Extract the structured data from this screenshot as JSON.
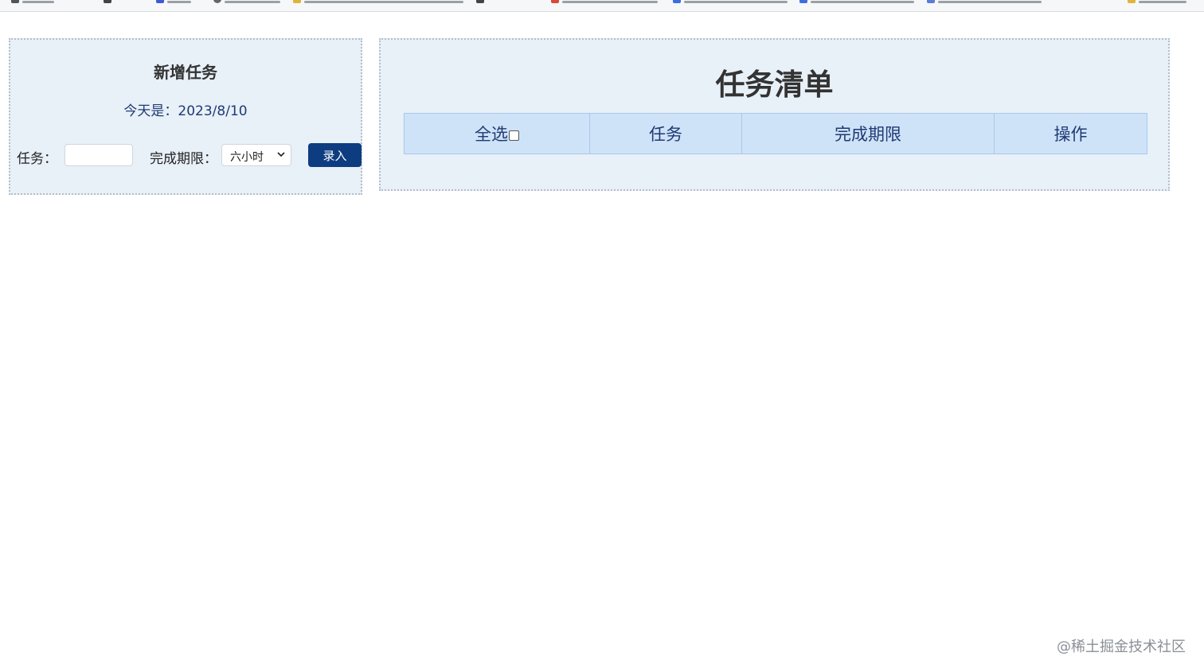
{
  "add_panel": {
    "title": "新增任务",
    "today_text": "今天是：2023/8/10",
    "task_label": "任务：",
    "task_value": "",
    "deadline_label": "完成期限：",
    "deadline_selected": "六小时",
    "submit_label": "录入"
  },
  "list_panel": {
    "title": "任务清单",
    "columns": {
      "select_all": "全选",
      "task": "任务",
      "deadline": "完成期限",
      "actions": "操作"
    }
  },
  "watermark": "@稀土掘金技术社区",
  "colors": {
    "panel_bg": "#e8f0f8",
    "header_bg": "#cfe3f8",
    "button_bg": "#0d3d80",
    "text_blue": "#1f3a73"
  }
}
